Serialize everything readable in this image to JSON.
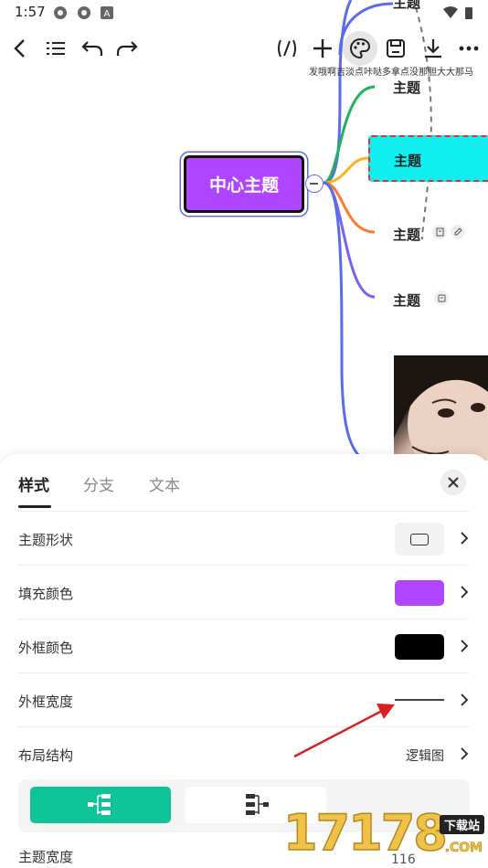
{
  "status_bar": {
    "time": "1:57"
  },
  "toolbar": {
    "marquee_text": "发哦啊吉淡点咔哒多拿点没那胆大大那马"
  },
  "mindmap": {
    "center_topic": "中心主题",
    "topics": [
      "主题",
      "主题",
      "主题",
      "主题",
      "主题"
    ],
    "branch_colors": [
      "#5a6bf0",
      "#1db35a",
      "#ffb21a",
      "#ff7a2e",
      "#7a63f0"
    ],
    "center_fill": "#b045ff",
    "selected_fill": "#10eef0"
  },
  "panel": {
    "tabs": [
      "样式",
      "分支",
      "文本"
    ],
    "rows": {
      "shape": {
        "label": "主题形状"
      },
      "fill": {
        "label": "填充颜色",
        "color": "#b045ff"
      },
      "border_color": {
        "label": "外框颜色",
        "color": "#000000"
      },
      "border_width": {
        "label": "外框宽度"
      },
      "layout": {
        "label": "布局结构",
        "value": "逻辑图"
      }
    },
    "layout_accent": "#10c49a",
    "topic_width": {
      "label": "主题宽度",
      "value": "116"
    }
  },
  "watermark": {
    "number": "17178",
    "tag": "下载站",
    "domain": ".COM"
  }
}
